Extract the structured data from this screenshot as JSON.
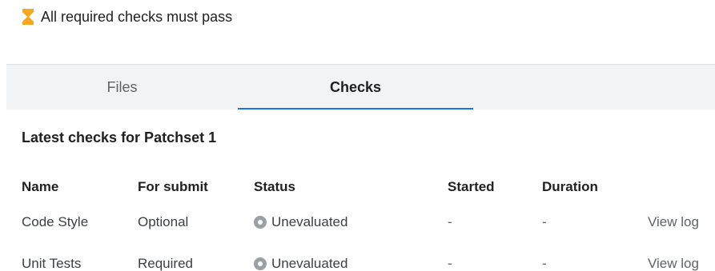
{
  "submit_status": {
    "icon": "hourglass-icon",
    "icon_color": "#f5a623",
    "text": "All required checks must pass"
  },
  "tabs": [
    {
      "label": "Files",
      "selected": false
    },
    {
      "label": "Checks",
      "selected": true
    }
  ],
  "accent_color": "#1a73e8",
  "section": {
    "title": "Latest checks for Patchset 1"
  },
  "table": {
    "columns": [
      "Name",
      "For submit",
      "Status",
      "Started",
      "Duration"
    ],
    "rows": [
      {
        "name": "Code Style",
        "for_submit": "Optional",
        "status_icon": "unevaluated-icon",
        "status": "Unevaluated",
        "started": "-",
        "duration": "-",
        "action": "View log"
      },
      {
        "name": "Unit Tests",
        "for_submit": "Required",
        "status_icon": "unevaluated-icon",
        "status": "Unevaluated",
        "started": "-",
        "duration": "-",
        "action": "View log"
      }
    ]
  }
}
